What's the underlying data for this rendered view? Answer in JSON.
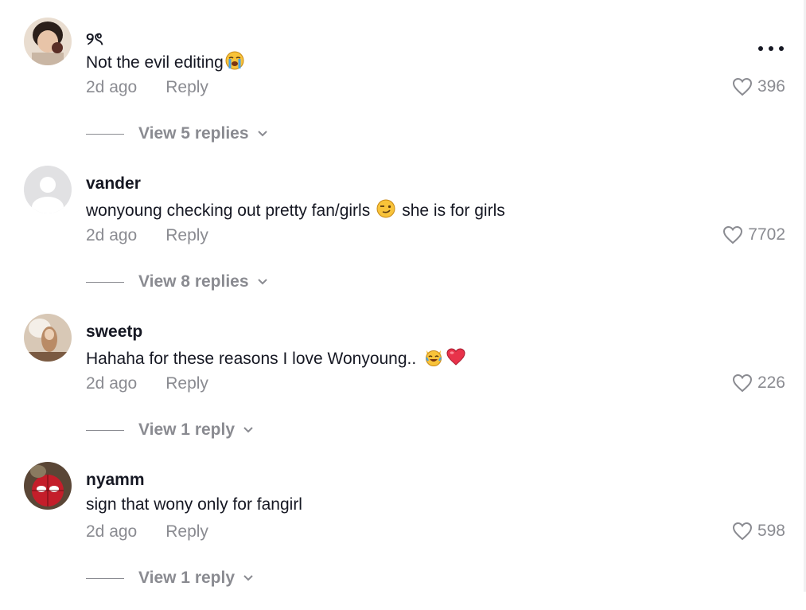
{
  "comments": [
    {
      "username": "୨ৎ",
      "text": "Not the evil editing",
      "emoji": "crying-emoji",
      "time": "2d ago",
      "reply_label": "Reply",
      "likes": "396",
      "view_replies": "View 5 replies"
    },
    {
      "username": "vander",
      "text": "wonyoung checking out pretty fan/girls",
      "emoji": "smirk-emoji",
      "text_after": "she is for girls",
      "time": "2d ago",
      "reply_label": "Reply",
      "likes": "7702",
      "view_replies": "View 8 replies"
    },
    {
      "username": "sweetp",
      "text": "Hahaha for these reasons I love Wonyoung..",
      "emoji": "joy-cat-emoji",
      "emoji2": "heart-emoji",
      "time": "2d ago",
      "reply_label": "Reply",
      "likes": "226",
      "view_replies": "View 1 reply"
    },
    {
      "username": "nyamm",
      "text": "sign that wony only for fangirl",
      "time": "2d ago",
      "reply_label": "Reply",
      "likes": "598",
      "view_replies": "View 1 reply"
    }
  ],
  "colors": {
    "text": "#161823",
    "muted": "#8a8b91",
    "background": "#ffffff"
  }
}
